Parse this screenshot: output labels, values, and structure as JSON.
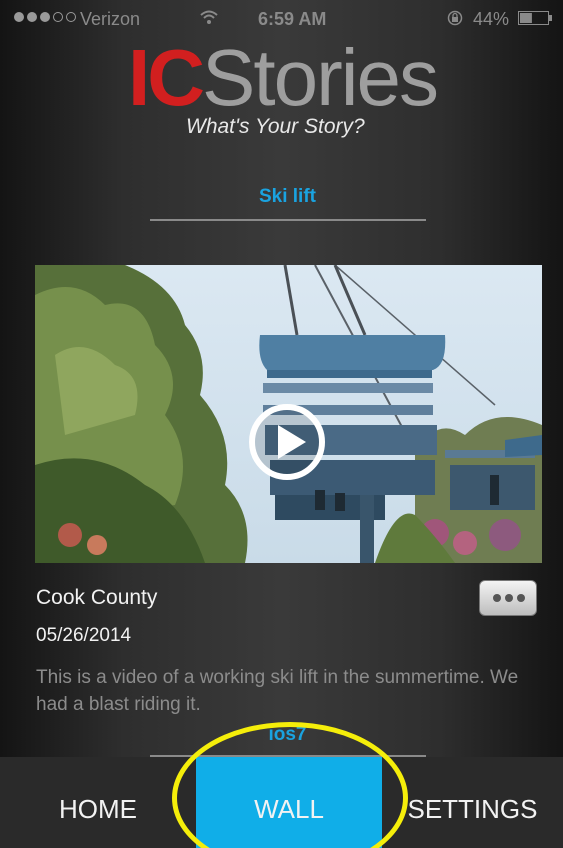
{
  "status_bar": {
    "signal_bars_filled": 3,
    "signal_bars_total": 5,
    "carrier": "Verizon",
    "time": "6:59 AM",
    "battery": "44%",
    "battery_level": 0.44,
    "icons": [
      "wifi-icon",
      "lock-rotation-icon",
      "battery-icon"
    ]
  },
  "header": {
    "logo_accent": "IC",
    "logo_rest": "Stories",
    "tagline": "What's Your Story?",
    "accent_color": "#d21f1f"
  },
  "story": {
    "title": "Ski lift",
    "location": "Cook County",
    "date": "05/26/2014",
    "description": "This is a video of a working ski lift in the summertime. We had a blast riding it.",
    "media": "video-thumbnail",
    "play_icon": "play-icon",
    "more_icon": "more-dots-icon"
  },
  "next_story": {
    "title": "ios7"
  },
  "tabs": [
    {
      "label": "HOME",
      "active": false
    },
    {
      "label": "WALL",
      "active": true
    },
    {
      "label": "SETTINGS",
      "active": false
    }
  ],
  "colors": {
    "link_blue": "#1aa3e0",
    "active_tab": "#10aee8",
    "annotation_ring": "#f5ee0a"
  }
}
